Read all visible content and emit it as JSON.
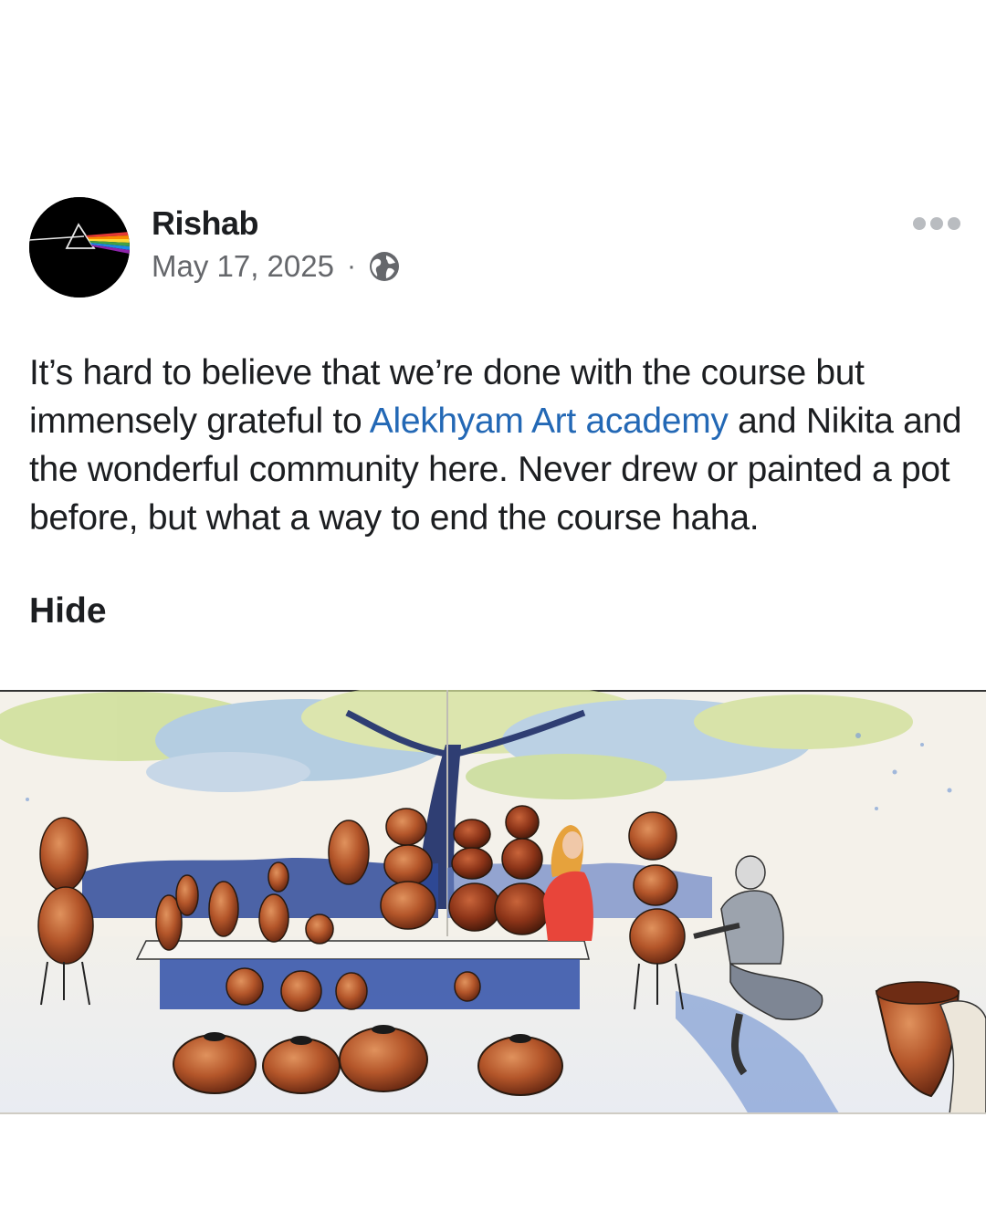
{
  "post": {
    "author": "Rishab",
    "date": "May 17, 2025",
    "separator": "·",
    "privacy_icon": "globe-icon",
    "more_icon": "more-options-icon",
    "text_before_mention": "It’s hard to believe that we’re done with the course but immensely grateful to ",
    "mention": "Alekhyam Art academy",
    "text_after_mention": " and Nikita and the wonderful community here. Never drew or painted a pot before, but what a way to end the course haha.",
    "hide_label": "Hide",
    "image_subject": "watercolor painting of a pottery stall under a tree",
    "mention_color": "#2368b5"
  }
}
